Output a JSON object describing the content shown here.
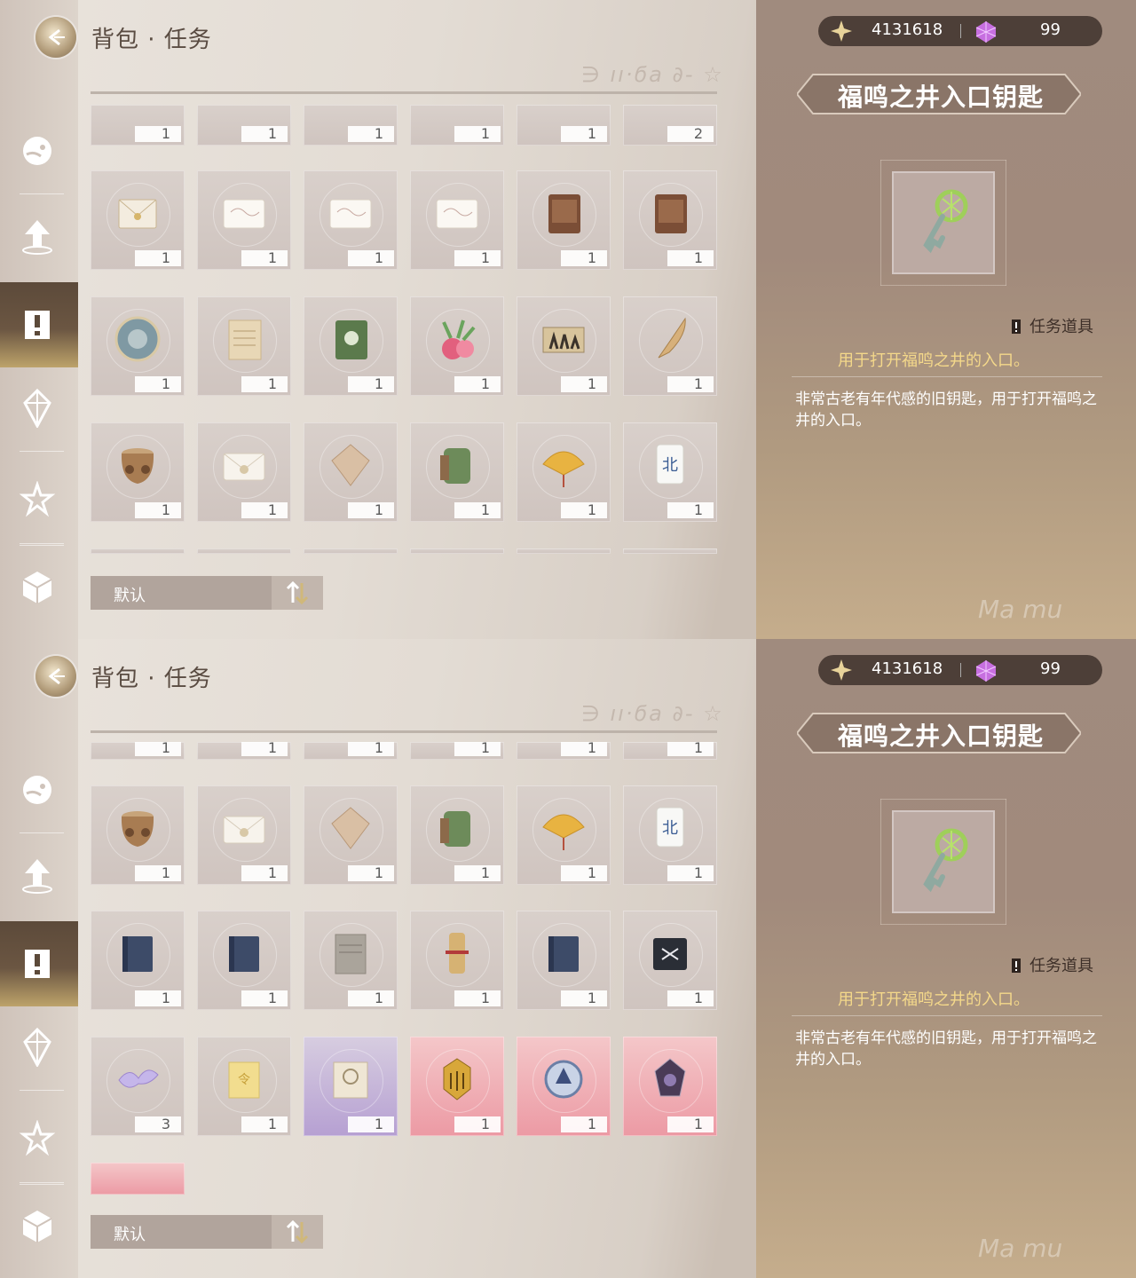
{
  "panels": [
    {
      "header": {
        "title": "背包 · 任务",
        "script": "∋ ıı·ϭa ∂- ☆"
      },
      "partial_counts": [
        "1",
        "1",
        "1",
        "1",
        "1",
        "2"
      ],
      "grid": [
        [
          {
            "icon": "letter-icon",
            "count": "1"
          },
          {
            "icon": "card-icon",
            "count": "1"
          },
          {
            "icon": "card-icon",
            "count": "1"
          },
          {
            "icon": "card-icon",
            "count": "1"
          },
          {
            "icon": "brown-book-icon",
            "count": "1"
          },
          {
            "icon": "brown-book-icon",
            "count": "1"
          }
        ],
        [
          {
            "icon": "round-shield-icon",
            "count": "1"
          },
          {
            "icon": "old-paper-icon",
            "count": "1"
          },
          {
            "icon": "green-book-icon",
            "count": "1"
          },
          {
            "icon": "radish-icon",
            "count": "1"
          },
          {
            "icon": "map-icon",
            "count": "1"
          },
          {
            "icon": "feather-icon",
            "count": "1"
          }
        ],
        [
          {
            "icon": "pot-icon",
            "count": "1"
          },
          {
            "icon": "envelope-icon",
            "count": "1"
          },
          {
            "icon": "gem-card-icon",
            "count": "1"
          },
          {
            "icon": "green-pouch-icon",
            "count": "1"
          },
          {
            "icon": "fan-icon",
            "count": "1"
          },
          {
            "icon": "mahjong-tile-icon",
            "count": "1"
          }
        ]
      ],
      "sort": {
        "label": "默认"
      }
    },
    {
      "header": {
        "title": "背包 · 任务",
        "script": "∋ ıı·ϭa ∂- ☆"
      },
      "partial_counts": [
        "1",
        "1",
        "1",
        "1",
        "1",
        "1"
      ],
      "grid": [
        [
          {
            "icon": "pot-icon",
            "count": "1"
          },
          {
            "icon": "envelope-icon",
            "count": "1"
          },
          {
            "icon": "gem-card-icon",
            "count": "1"
          },
          {
            "icon": "green-pouch-icon",
            "count": "1"
          },
          {
            "icon": "fan-icon",
            "count": "1"
          },
          {
            "icon": "mahjong-tile-icon",
            "count": "1"
          }
        ],
        [
          {
            "icon": "blue-book-icon",
            "count": "1"
          },
          {
            "icon": "blue-book-icon",
            "count": "1"
          },
          {
            "icon": "grey-paper-icon",
            "count": "1"
          },
          {
            "icon": "scroll-icon",
            "count": "1"
          },
          {
            "icon": "blue-book-icon",
            "count": "1"
          },
          {
            "icon": "black-card-icon",
            "count": "1"
          }
        ],
        [
          {
            "icon": "blossom-icon",
            "count": "3"
          },
          {
            "icon": "yellow-note-icon",
            "count": "1"
          },
          {
            "icon": "certificate-icon",
            "count": "1",
            "rarity": "purple"
          },
          {
            "icon": "gold-crest-icon",
            "count": "1",
            "rarity": "pink"
          },
          {
            "icon": "silver-crest-icon",
            "count": "1",
            "rarity": "pink"
          },
          {
            "icon": "dark-crest-icon",
            "count": "1",
            "rarity": "pink"
          }
        ]
      ],
      "extra_cell": {
        "rarity": "pink"
      },
      "sort": {
        "label": "默认"
      }
    }
  ],
  "currency": {
    "stars": "4131618",
    "gems": "99"
  },
  "detail": {
    "name": "福鸣之井入口钥匙",
    "type": "任务道具",
    "use": "用于打开福鸣之井的入口。",
    "description": "非常古老有年代感的旧钥匙，用于打开福鸣之井的入口。",
    "signature": "Ma mu"
  },
  "sidebar": [
    {
      "name": "sidebar-fish-icon"
    },
    {
      "name": "sidebar-upgrade-icon"
    },
    {
      "name": "sidebar-quest-icon",
      "active": true
    },
    {
      "name": "sidebar-crystal-icon"
    },
    {
      "name": "sidebar-star-wand-icon"
    },
    {
      "name": "sidebar-cube-icon"
    }
  ]
}
